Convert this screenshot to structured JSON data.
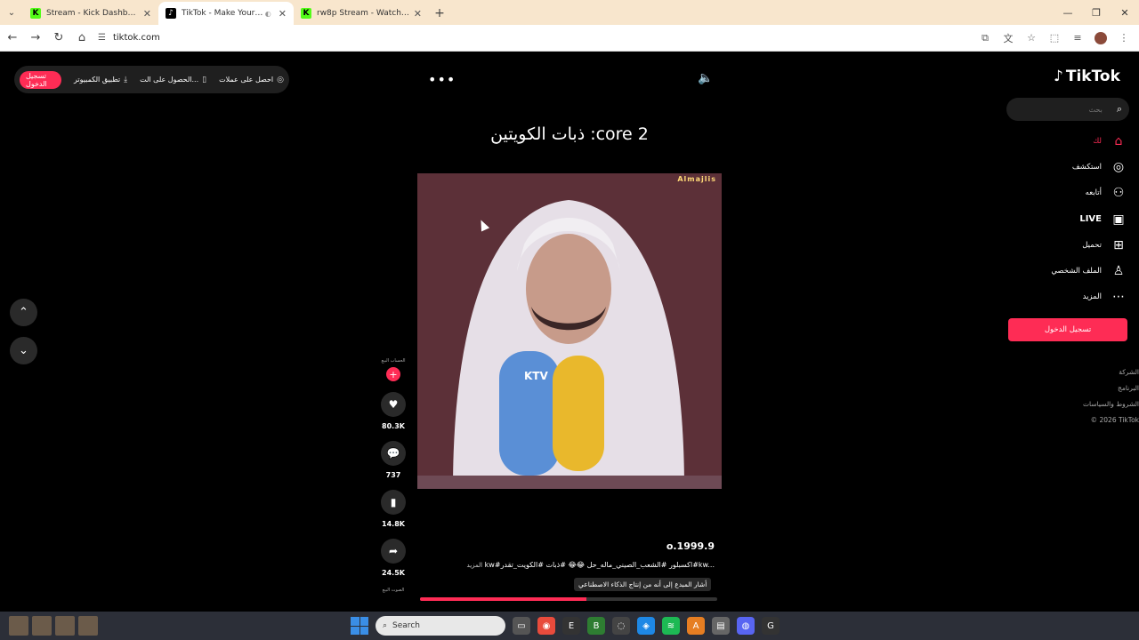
{
  "browser": {
    "tabs": [
      {
        "title": "Stream - Kick Dashboard",
        "favicon": "K",
        "favicon_color": "#53fc18",
        "active": false
      },
      {
        "title": "TikTok - Make Your Day",
        "favicon": "♪",
        "favicon_color": "#000000",
        "active": true
      },
      {
        "title": "rw8p Stream - Watch Live on Ki",
        "favicon": "K",
        "favicon_color": "#53fc18",
        "active": false
      }
    ],
    "url": "tiktok.com"
  },
  "top_bar": {
    "login_label": "تسجيل الدخول",
    "desktop_app_label": "تطبيق الكمبيوتر",
    "get_app_label": "الحصول على الت...",
    "coins_label": "احصل على عملات"
  },
  "brand": {
    "logo_text": "TikTok",
    "accent_color": "#fe2c55"
  },
  "search": {
    "placeholder": "بحث"
  },
  "sidebar": {
    "items": [
      {
        "label": "لك",
        "icon": "home-icon",
        "active": true
      },
      {
        "label": "استكشف",
        "icon": "compass-icon",
        "active": false
      },
      {
        "label": "أتابعه",
        "icon": "following-icon",
        "active": false
      },
      {
        "label": "LIVE",
        "icon": "live-icon",
        "active": false
      },
      {
        "label": "تحميل",
        "icon": "upload-icon",
        "active": false
      },
      {
        "label": "الملف الشخصي",
        "icon": "profile-icon",
        "active": false
      },
      {
        "label": "المزيد",
        "icon": "more-icon",
        "active": false
      }
    ],
    "login_label": "تسجيل الدخول",
    "links": [
      "الشركة",
      "البرنامج",
      "الشروط والسياسات",
      "© 2026 TikTok"
    ]
  },
  "video": {
    "title": "ذبات الكويتين :core 2",
    "watermark": "Almajlis",
    "author": "o.1999.9",
    "caption": "kw#اكسبلور #الشعب_الصيني_ماله_حل 😂😂 #ذبات #الكويت_تقدر#kw...",
    "more_label": "المزيد",
    "ai_badge": "أشار المبدع إلى أنه من إنتاج الذكاء الاصطناعي",
    "progress": 0.56
  },
  "actions": {
    "avatar_label": "الحساب البيع",
    "likes": "80.3K",
    "comments": "737",
    "saves": "14.8K",
    "shares": "24.5K",
    "bottom_label": "الصوت البيع"
  },
  "taskbar": {
    "search_label": "Search"
  }
}
